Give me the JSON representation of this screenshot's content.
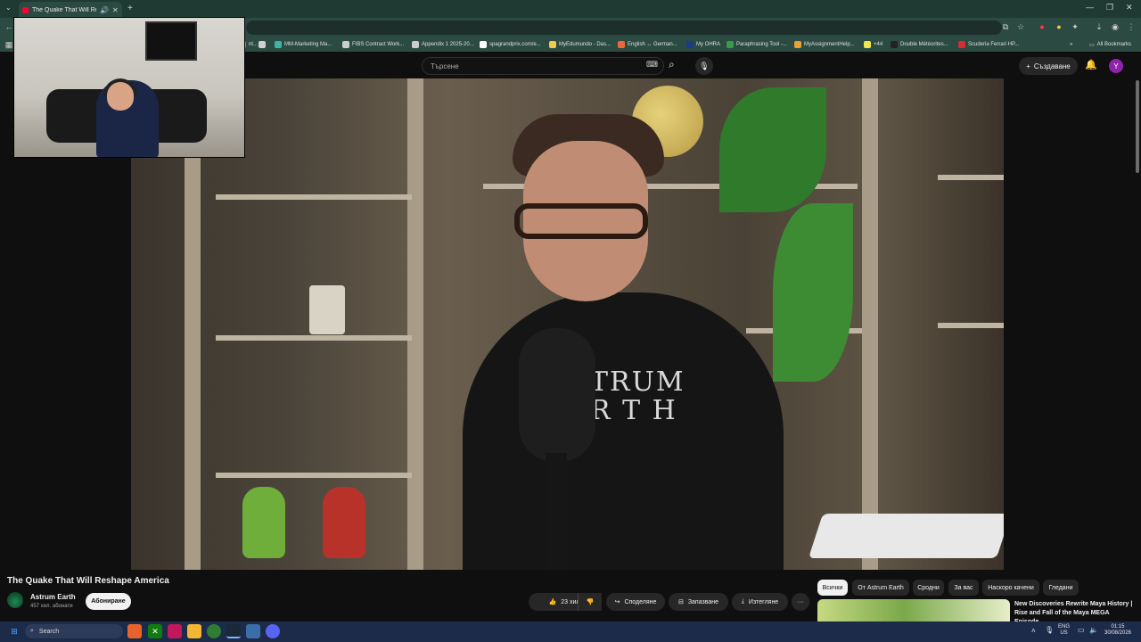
{
  "browser": {
    "active_tab_title": "The Quake That Will Reshape America",
    "new_tab_glyph": "+",
    "minimize_glyph": "—",
    "maximize_glyph": "❐",
    "close_glyph": "✕",
    "all_bookmarks_label": "All Bookmarks"
  },
  "bookmarks": [
    {
      "label": "nt...",
      "color": "#888888"
    },
    {
      "label": "",
      "color": "#d0d0d0"
    },
    {
      "label": "MM-Marketing Ma...",
      "color": "#3cb4a8"
    },
    {
      "label": "FIBS Contract Work...",
      "color": "#cccccc"
    },
    {
      "label": "Appendix 1 2025-20...",
      "color": "#cccccc"
    },
    {
      "label": "spagrandprix.com/e...",
      "color": "#ffffff"
    },
    {
      "label": "MyEdumundo - Das...",
      "color": "#f2c94c"
    },
    {
      "label": "English ↔ German...",
      "color": "#e86a3a"
    },
    {
      "label": "My OHRA",
      "color": "#1e3a8a"
    },
    {
      "label": "Paraphrasing Tool -...",
      "color": "#3a9a4a"
    },
    {
      "label": "MyAssignmentHelp...",
      "color": "#e8a030"
    },
    {
      "label": "+44",
      "color": "#f2e64c"
    },
    {
      "label": "Double Météorites...",
      "color": "#222222"
    },
    {
      "label": "Scuderia Ferrari HP...",
      "color": "#d32f2f"
    }
  ],
  "youtube": {
    "search_placeholder": "Търсене",
    "create_label": "Създаване",
    "avatar_letter": "Y",
    "video_title": "The Quake That Will Reshape America",
    "channel_name": "Astrum Earth",
    "subscriber_count": "457 хил. абонати",
    "subscribe_label": "Абониране",
    "likes": "23 хил.",
    "share_label": "Споделяне",
    "save_label": "Запазване",
    "download_label": "Изтегляне",
    "more_glyph": "···",
    "shirt_line1": "TRUM",
    "shirt_line2": "R T H",
    "chips": [
      "Всички",
      "От Astrum Earth",
      "Сродни",
      "За вас",
      "Наскоро качени",
      "Гледани"
    ],
    "recommended_title": "New Discoveries Rewrite Maya History | Rise and Fall of the Maya MEGA Episode"
  },
  "taskbar": {
    "search_label": "Search",
    "lang_top": "ENG",
    "lang_bottom": "US",
    "time": "01:15",
    "date": "30/08/2026"
  },
  "colors": {
    "youtube_red": "#ff0033",
    "browser_frame": "#2b4a42",
    "taskbar": "#1c2b4a"
  }
}
